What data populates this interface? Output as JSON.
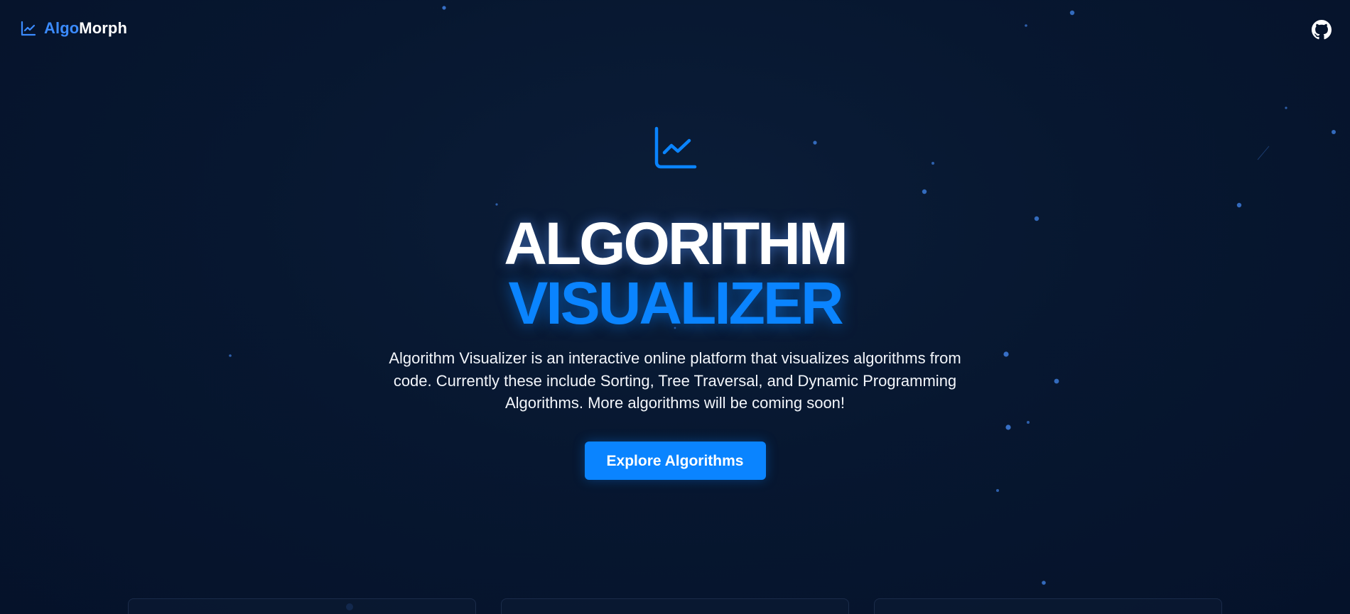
{
  "header": {
    "brand_part_a": "Algo",
    "brand_part_b": "Morph",
    "logo_icon": "chart-line-icon",
    "github_icon": "github-icon"
  },
  "hero": {
    "icon": "chart-line-icon",
    "title_line_1": "ALGORITHM",
    "title_line_2": "VISUALIZER",
    "description": "Algorithm Visualizer is an interactive online platform that visualizes algorithms from code. Currently these include Sorting, Tree Traversal, and Dynamic Programming Algorithms. More algorithms will be coming soon!",
    "cta_label": "Explore Algorithms"
  },
  "colors": {
    "background": "#05122a",
    "accent": "#0a84ff",
    "brand_accent": "#3b8bff",
    "text": "#ffffff"
  },
  "cards": {
    "count_visible": 3
  }
}
